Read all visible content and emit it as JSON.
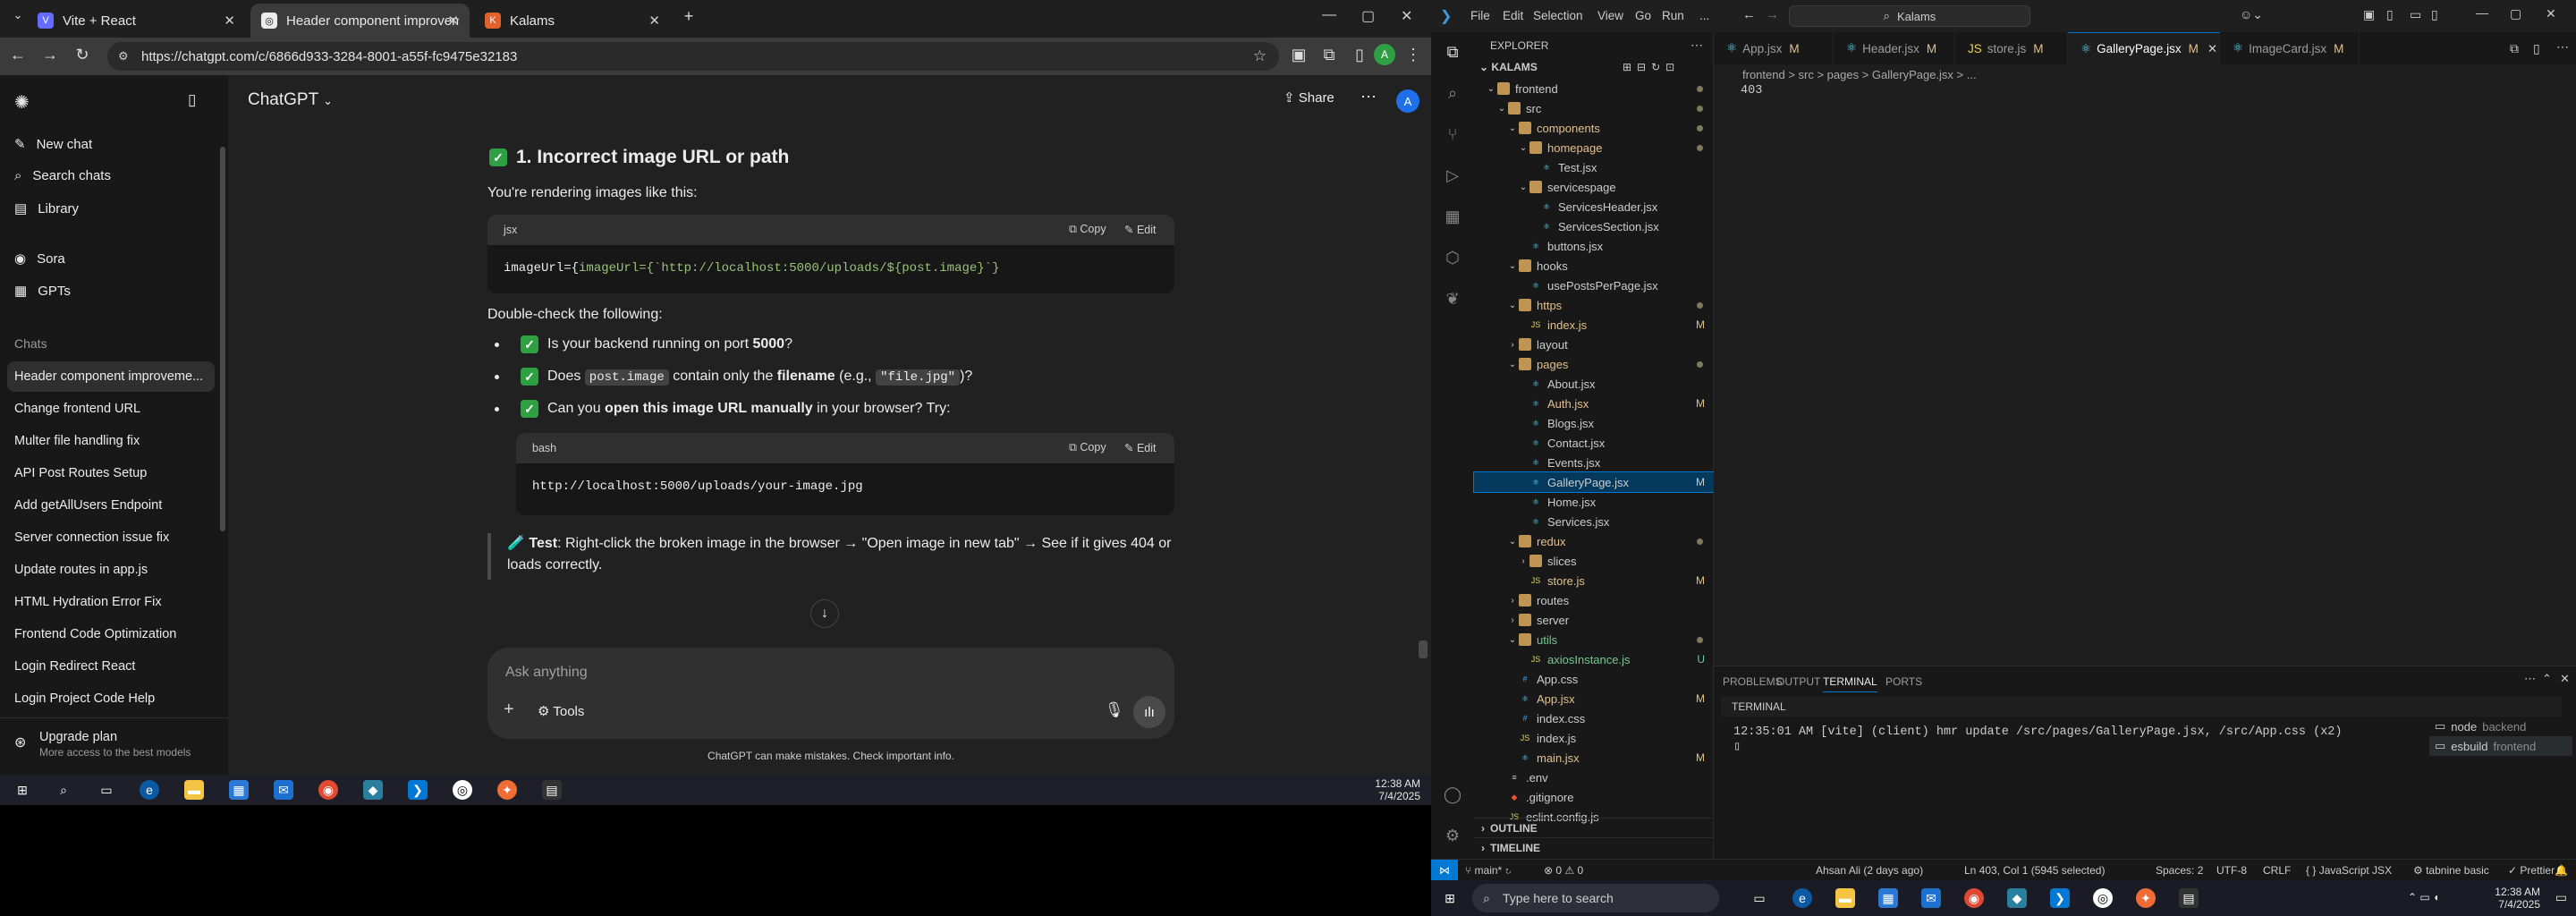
{
  "browser": {
    "tabs": [
      {
        "title": "Vite + React",
        "color": "#646cff"
      },
      {
        "title": "Header component improveme",
        "color": "#ececec"
      },
      {
        "title": "Kalams",
        "color": "#e0612b"
      }
    ],
    "url": "https://chatgpt.com/c/6866d933-3284-8001-a55f-fc9475e32183"
  },
  "chatgpt": {
    "model_title": "ChatGPT",
    "nav": [
      "New chat",
      "Search chats",
      "Library"
    ],
    "nav2": [
      "Sora",
      "GPTs"
    ],
    "chats_heading": "Chats",
    "chats": [
      "Header component improveme...",
      "Change frontend URL",
      "Multer file handling fix",
      "API Post Routes Setup",
      "Add getAllUsers Endpoint",
      "Server connection issue fix",
      "Update routes in app.js",
      "HTML Hydration Error Fix",
      "Frontend Code Optimization",
      "Login Redirect React",
      "Login Project Code Help"
    ],
    "upgrade": {
      "title": "Upgrade plan",
      "subtitle": "More access to the best models"
    },
    "share_label": "Share",
    "avatar_letter": "A",
    "message": {
      "heading": "1. Incorrect image URL or path",
      "intro": "You're rendering images like this:",
      "code1_lang": "jsx",
      "code1": "imageUrl={`http://localhost:5000/uploads/${post.image}`}",
      "copy_label": "Copy",
      "edit_label": "Edit",
      "double_check": "Double-check the following:",
      "b1_pre": "Is your backend running on port ",
      "b1_bold": "5000",
      "b1_post": "?",
      "b2_pre": "Does ",
      "b2_code": "post.image",
      "b2_mid": " contain only the ",
      "b2_bold": "filename",
      "b2_mid2": " (e.g., ",
      "b2_code2": "\"file.jpg\"",
      "b2_post": ")?",
      "b3_pre": "Can you ",
      "b3_bold": "open this image URL manually",
      "b3_post": " in your browser? Try:",
      "code2_lang": "bash",
      "code2": "http://localhost:5000/uploads/your-image.jpg",
      "test_bold": "Test",
      "test_line1": ": Right-click the broken image in the browser → \"Open image in new tab\" → See if it gives 404 or",
      "test_line2": "loads correctly."
    },
    "composer": {
      "placeholder": "Ask anything",
      "tools_label": "Tools"
    },
    "disclaimer": "ChatGPT can make mistakes. Check important info."
  },
  "taskbar_left": {
    "time": "12:38 AM",
    "date": "7/4/2025"
  },
  "vscode": {
    "menu": [
      "File",
      "Edit",
      "Selection",
      "View",
      "Go",
      "Run",
      "..."
    ],
    "command_center": "Kalams",
    "explorer_title": "EXPLORER",
    "root": "KALAMS",
    "tree": [
      {
        "d": 1,
        "t": "folder-open",
        "n": "frontend",
        "dot": true
      },
      {
        "d": 2,
        "t": "folder-open",
        "n": "src",
        "dot": true
      },
      {
        "d": 3,
        "t": "folder-open",
        "n": "components",
        "dot": true,
        "mod": true
      },
      {
        "d": 4,
        "t": "folder-open",
        "n": "homepage",
        "dot": true,
        "mod": true
      },
      {
        "d": 5,
        "t": "file",
        "n": "Test.jsx"
      },
      {
        "d": 4,
        "t": "folder-open",
        "n": "servicespage"
      },
      {
        "d": 5,
        "t": "file",
        "n": "ServicesHeader.jsx"
      },
      {
        "d": 5,
        "t": "file",
        "n": "ServicesSection.jsx"
      },
      {
        "d": 4,
        "t": "file",
        "n": "buttons.jsx"
      },
      {
        "d": 3,
        "t": "folder-open",
        "n": "hooks"
      },
      {
        "d": 4,
        "t": "file",
        "n": "usePostsPerPage.jsx"
      },
      {
        "d": 3,
        "t": "folder-open",
        "n": "https",
        "dot": true,
        "mod": true
      },
      {
        "d": 4,
        "t": "file",
        "n": "index.js",
        "badge": "M",
        "mod": true
      },
      {
        "d": 3,
        "t": "folder",
        "n": "layout"
      },
      {
        "d": 3,
        "t": "folder-open",
        "n": "pages",
        "dot": true,
        "mod": true
      },
      {
        "d": 4,
        "t": "file",
        "n": "About.jsx"
      },
      {
        "d": 4,
        "t": "file",
        "n": "Auth.jsx",
        "badge": "M",
        "mod": true
      },
      {
        "d": 4,
        "t": "file",
        "n": "Blogs.jsx"
      },
      {
        "d": 4,
        "t": "file",
        "n": "Contact.jsx"
      },
      {
        "d": 4,
        "t": "file",
        "n": "Events.jsx"
      },
      {
        "d": 4,
        "t": "file",
        "n": "GalleryPage.jsx",
        "badge": "M",
        "sel": true
      },
      {
        "d": 4,
        "t": "file",
        "n": "Home.jsx"
      },
      {
        "d": 4,
        "t": "file",
        "n": "Services.jsx"
      },
      {
        "d": 3,
        "t": "folder-open",
        "n": "redux",
        "dot": true,
        "mod": true
      },
      {
        "d": 4,
        "t": "folder",
        "n": "slices"
      },
      {
        "d": 4,
        "t": "file",
        "n": "store.js",
        "badge": "M",
        "mod": true
      },
      {
        "d": 3,
        "t": "folder",
        "n": "routes"
      },
      {
        "d": 3,
        "t": "folder",
        "n": "server"
      },
      {
        "d": 3,
        "t": "folder-open",
        "n": "utils",
        "dot": true,
        "unt": true
      },
      {
        "d": 4,
        "t": "file",
        "n": "axiosInstance.js",
        "badge": "U",
        "unt": true
      },
      {
        "d": 3,
        "t": "file",
        "n": "App.css"
      },
      {
        "d": 3,
        "t": "file",
        "n": "App.jsx",
        "badge": "M",
        "mod": true
      },
      {
        "d": 3,
        "t": "file",
        "n": "index.css"
      },
      {
        "d": 3,
        "t": "file",
        "n": "index.js"
      },
      {
        "d": 3,
        "t": "file",
        "n": "main.jsx",
        "badge": "M",
        "mod": true
      },
      {
        "d": 2,
        "t": "file",
        "n": ".env"
      },
      {
        "d": 2,
        "t": "file",
        "n": ".gitignore"
      },
      {
        "d": 2,
        "t": "file",
        "n": "eslint.config.js"
      }
    ],
    "outline_label": "OUTLINE",
    "timeline_label": "TIMELINE",
    "tabs": [
      {
        "n": "App.jsx",
        "m": "M"
      },
      {
        "n": "Header.jsx",
        "m": "M"
      },
      {
        "n": "store.js",
        "m": "M"
      },
      {
        "n": "GalleryPage.jsx",
        "m": "M",
        "active": true
      },
      {
        "n": "ImageCard.jsx",
        "m": "M"
      }
    ],
    "breadcrumb": "frontend > src > pages > GalleryPage.jsx > ...",
    "editor_line": "403",
    "panel_tabs": [
      "PROBLEMS",
      "OUTPUT",
      "TERMINAL",
      "PORTS"
    ],
    "terminal_label": "TERMINAL",
    "terminal_line": "12:35:01 AM [vite] (client) hmr update /src/pages/GalleryPage.jsx, /src/App.css (x2)",
    "terminals": [
      {
        "n": "node",
        "s": "backend"
      },
      {
        "n": "esbuild",
        "s": "frontend"
      }
    ],
    "status": {
      "branch": "main*",
      "problems": "⊗ 0 ⚠ 0",
      "author": "Ahsan Ali (2 days ago)",
      "cursor": "Ln 403, Col 1 (5945 selected)",
      "spaces": "Spaces: 2",
      "encoding": "UTF-8",
      "eol": "CRLF",
      "lang": "JavaScript JSX",
      "tabnine": "tabnine basic",
      "prettier": "Prettier"
    }
  },
  "taskbar_right": {
    "search_placeholder": "Type here to search",
    "time": "12:38 AM",
    "date": "7/4/2025"
  }
}
